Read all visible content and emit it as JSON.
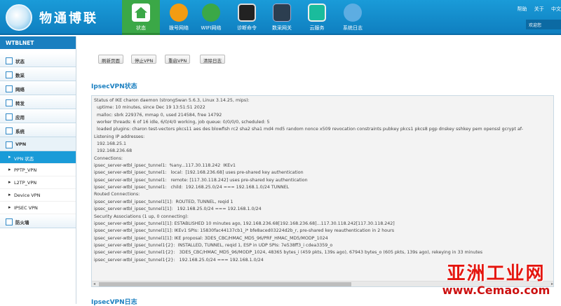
{
  "header": {
    "brand": "物通博联",
    "nav": [
      {
        "label": "状态",
        "icon": "home-icon",
        "active": true
      },
      {
        "label": "拨号网络",
        "icon": "broadcast-icon"
      },
      {
        "label": "WIFI网络",
        "icon": "wifi-icon"
      },
      {
        "label": "诊断命令",
        "icon": "terminal-icon"
      },
      {
        "label": "数采网关",
        "icon": "gateway-icon"
      },
      {
        "label": "云服务",
        "icon": "cloud-icon"
      },
      {
        "label": "系统日志",
        "icon": "stethoscope-icon"
      }
    ],
    "help": "帮助",
    "about": "关于",
    "lang": "中文",
    "welcome": "欢迎您"
  },
  "sidebar": {
    "title": "WTBLNET",
    "items": [
      {
        "label": "状态"
      },
      {
        "label": "数采"
      },
      {
        "label": "网络"
      },
      {
        "label": "转发"
      },
      {
        "label": "应用"
      },
      {
        "label": "系统"
      },
      {
        "label": "VPN"
      }
    ],
    "vpn_sub": [
      {
        "label": "VPN 状态",
        "active": true
      },
      {
        "label": "PPTP_VPN"
      },
      {
        "label": "L2TP_VPN"
      },
      {
        "label": "Device VPN"
      },
      {
        "label": "IPSEC VPN"
      }
    ],
    "last_item": "防火墙"
  },
  "main": {
    "buttons": [
      "刷新页面",
      "停止VPN",
      "重启VPN",
      "清除日志"
    ],
    "status_title": "IpsecVPN状态",
    "log_title": "IpsecVPN日志",
    "status_lines": [
      "Status of IKE charon daemon (strongSwan 5.6.3, Linux 3.14.25, mips):",
      "  uptime: 10 minutes, since Dec 19 13:51:51 2022",
      "  malloc: sbrk 229376, mmap 0, used 214584, free 14792",
      "  worker threads: 6 of 16 idle, 6/0/4/0 working, job queue: 0/0/0/0, scheduled: 5",
      "  loaded plugins: charon test-vectors pkcs11 aes des blowfish rc2 sha2 sha1 md4 md5 random nonce x509 revocation constraints pubkey pkcs1 pkcs8 pgp dnskey sshkey pem openssl gcrypt af-",
      "Listening IP addresses:",
      "  192.168.25.1",
      "  192.168.236.68",
      "Connections:",
      "ipsec_server-wtbl_ipsec_tunnel1:  %any...117.30.118.242  IKEv1",
      "ipsec_server-wtbl_ipsec_tunnel1:   local:  [192.168.236.68] uses pre-shared key authentication",
      "ipsec_server-wtbl_ipsec_tunnel1:   remote: [117.30.118.242] uses pre-shared key authentication",
      "ipsec_server-wtbl_ipsec_tunnel1:   child:  192.168.25.0/24 === 192.168.1.0/24 TUNNEL",
      "Routed Connections:",
      "ipsec_server-wtbl_ipsec_tunnel1[1]:  ROUTED, TUNNEL, reqid 1",
      "ipsec_server-wtbl_ipsec_tunnel1[1]:   192.168.25.0/24 === 192.168.1.0/24",
      "Security Associations (1 up, 0 connecting):",
      "ipsec_server-wtbl_ipsec_tunnel1[1]: ESTABLISHED 10 minutes ago, 192.168.236.68[192.168.236.68]...117.30.118.242[117.30.118.242]",
      "ipsec_server-wtbl_ipsec_tunnel1[1]: IKEv1 SPIs: 15830fac44137cb1_i* bfe8aced03224d2b_r, pre-shared key reauthentication in 2 hours",
      "ipsec_server-wtbl_ipsec_tunnel1[1]: IKE proposal: 3DES_CBC/HMAC_MD5_96/PRF_HMAC_MD5/MODP_1024",
      "ipsec_server-wtbl_ipsec_tunnel1{2}:  INSTALLED, TUNNEL, reqid 1, ESP in UDP SPIs: 7e538ff3_i cdea3359_o",
      "ipsec_server-wtbl_ipsec_tunnel1{2}:   3DES_CBC/HMAC_MD5_96/MODP_1024, 48365 bytes_i (459 pkts, 139s ago), 67943 bytes_o (605 pkts, 139s ago), rekeying in 33 minutes",
      "ipsec_server-wtbl_ipsec_tunnel1{2}:   192.168.25.0/24 === 192.168.1.0/24"
    ]
  },
  "watermark": {
    "cn": "亚洲工业网",
    "url": "www.Cemao.com"
  }
}
